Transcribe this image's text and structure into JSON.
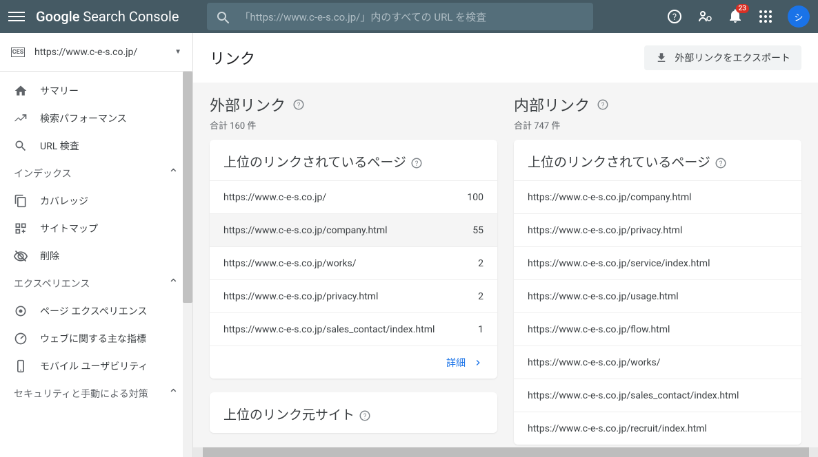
{
  "header": {
    "logo_bold": "Google",
    "logo_rest": " Search Console",
    "search_placeholder": "「https://www.c-e-s.co.jp/」内のすべての URL を検査",
    "notif_count": "23",
    "avatar_initial": "シ"
  },
  "property": {
    "icon_text": "CES",
    "url": "https://www.c-e-s.co.jp/"
  },
  "nav": {
    "summary": "サマリー",
    "performance": "検索パフォーマンス",
    "url_inspect": "URL 検査",
    "section_index": "インデックス",
    "coverage": "カバレッジ",
    "sitemaps": "サイトマップ",
    "removals": "削除",
    "section_exp": "エクスペリエンス",
    "page_exp": "ページ エクスペリエンス",
    "core_vitals": "ウェブに関する主な指標",
    "mobile_usability": "モバイル ユーザビリティ",
    "section_security": "セキュリティと手動による対策"
  },
  "main": {
    "title": "リンク",
    "export_label": "外部リンクをエクスポート"
  },
  "external": {
    "title": "外部リンク",
    "total": "合計 160 件",
    "card_title": "上位のリンクされているページ",
    "rows": [
      {
        "url": "https://www.c-e-s.co.jp/",
        "count": "100"
      },
      {
        "url": "https://www.c-e-s.co.jp/company.html",
        "count": "55"
      },
      {
        "url": "https://www.c-e-s.co.jp/works/",
        "count": "2"
      },
      {
        "url": "https://www.c-e-s.co.jp/privacy.html",
        "count": "2"
      },
      {
        "url": "https://www.c-e-s.co.jp/sales_contact/index.html",
        "count": "1"
      }
    ],
    "detail": "詳細",
    "next_card": "上位のリンク元サイト"
  },
  "internal": {
    "title": "内部リンク",
    "total": "合計 747 件",
    "card_title": "上位のリンクされているページ",
    "rows": [
      {
        "url": "https://www.c-e-s.co.jp/company.html"
      },
      {
        "url": "https://www.c-e-s.co.jp/privacy.html"
      },
      {
        "url": "https://www.c-e-s.co.jp/service/index.html"
      },
      {
        "url": "https://www.c-e-s.co.jp/usage.html"
      },
      {
        "url": "https://www.c-e-s.co.jp/flow.html"
      },
      {
        "url": "https://www.c-e-s.co.jp/works/"
      },
      {
        "url": "https://www.c-e-s.co.jp/sales_contact/index.html"
      },
      {
        "url": "https://www.c-e-s.co.jp/recruit/index.html"
      }
    ]
  }
}
